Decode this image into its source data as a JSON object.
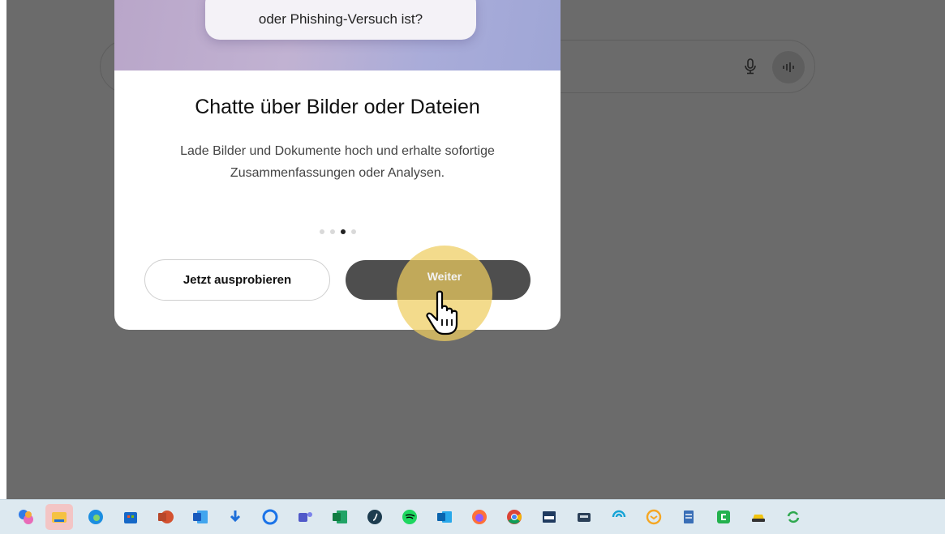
{
  "hero": {
    "bubble_text": "oder Phishing-Versuch ist?"
  },
  "modal": {
    "title": "Chatte über Bilder oder Dateien",
    "description": "Lade Bilder und Dokumente hoch und erhalte sofortige Zusammenfassungen oder Analysen.",
    "page_indicator": {
      "total": 4,
      "active_index": 3
    },
    "try_button_label": "Jetzt ausprobieren",
    "next_button_label": "Weiter"
  },
  "search": {
    "mic_icon": "microphone-icon",
    "voice_icon": "voice-waveform-icon"
  },
  "taskbar": {
    "apps": [
      "copilot-icon",
      "file-explorer-icon",
      "edge-icon",
      "store-icon",
      "powerpoint-icon",
      "word-icon",
      "download-icon",
      "onedrive-icon",
      "teams-icon",
      "excel-icon",
      "app-icon",
      "spotify-icon",
      "outlook-icon",
      "firefox-icon",
      "chrome-icon",
      "window-icon",
      "scanner-icon",
      "wifi-app-icon",
      "mail-icon",
      "notepad-icon",
      "green-app-icon",
      "car-app-icon",
      "sync-icon"
    ]
  }
}
